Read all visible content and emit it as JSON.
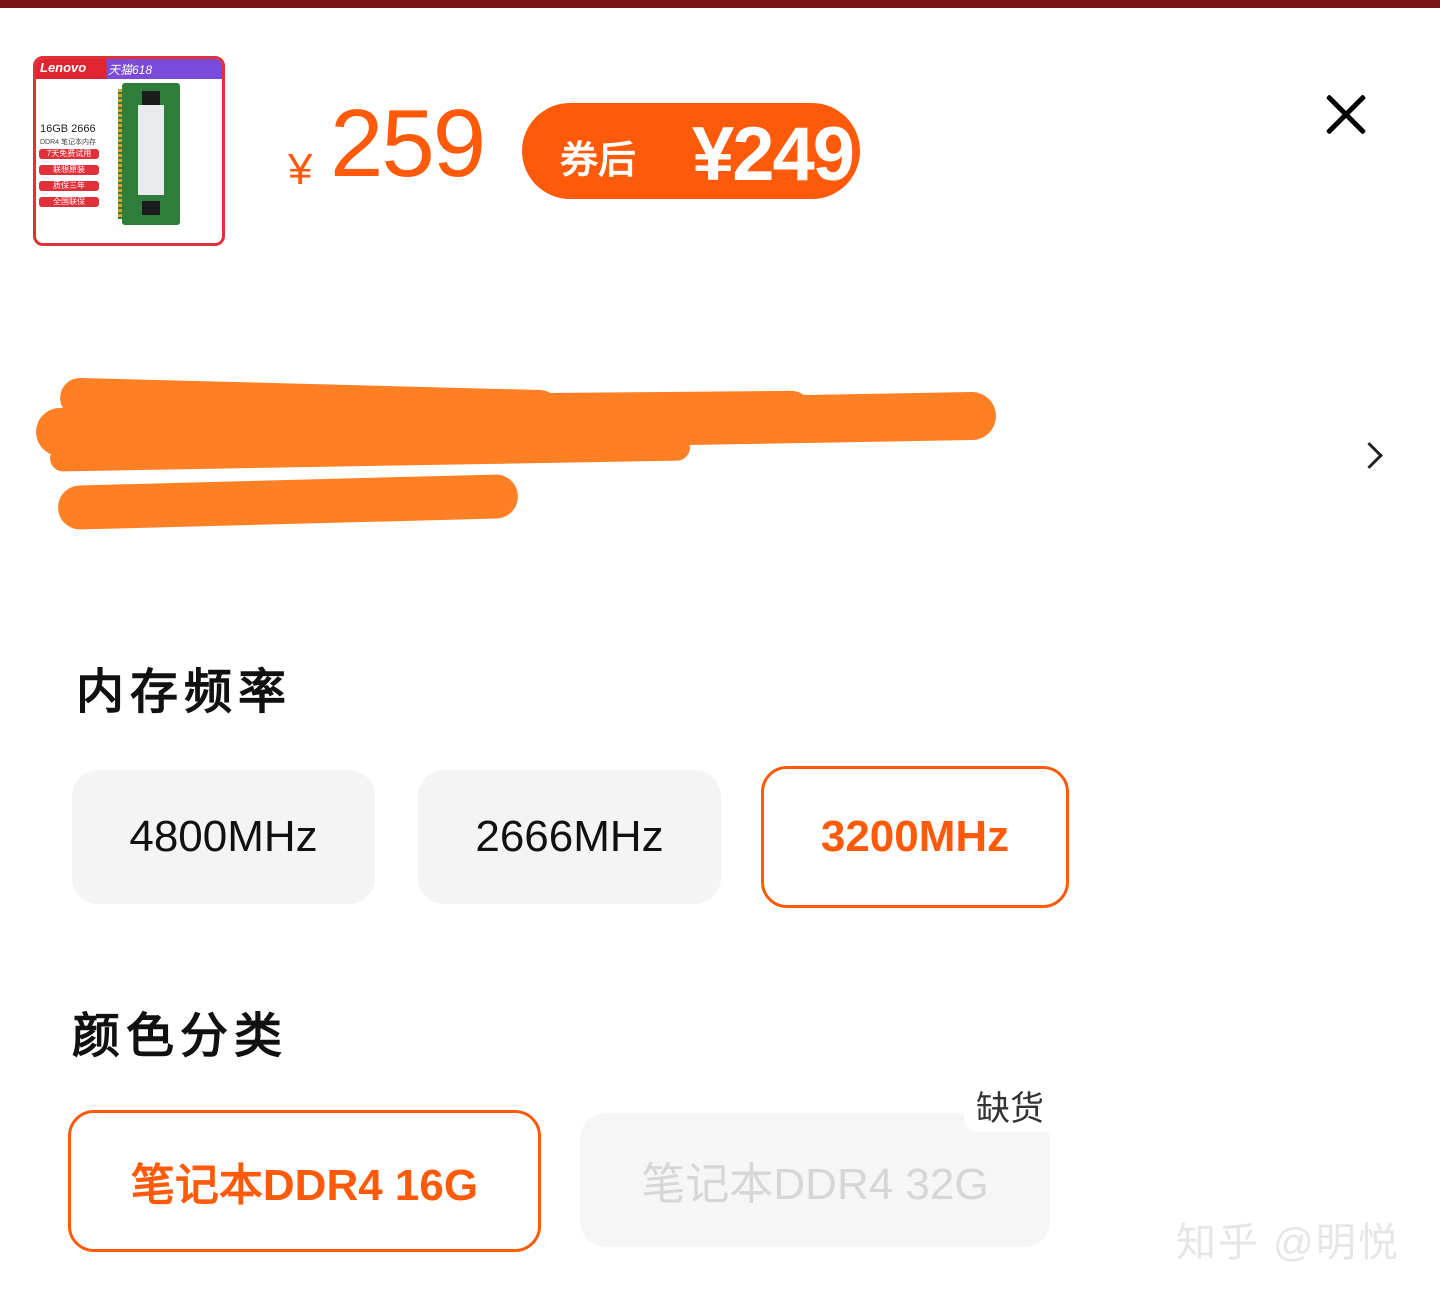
{
  "product": {
    "thumb_brand": "Lenovo",
    "thumb_promo": "天猫618",
    "thumb_spec": "16GB 2666",
    "thumb_spec_sub": "DDR4 笔记本内存",
    "thumb_tags": [
      "7天免费试用",
      "联想原装",
      "质保三年",
      "全国联保"
    ]
  },
  "price": {
    "currency": "¥",
    "original": "259",
    "coupon_label": "券后",
    "coupon_price": "¥249"
  },
  "colors": {
    "accent": "#ff5a0a",
    "redaction": "#ff7f24"
  },
  "memory_frequency": {
    "title": "内存频率",
    "options": [
      {
        "label": "4800MHz",
        "state": "available"
      },
      {
        "label": "2666MHz",
        "state": "available"
      },
      {
        "label": "3200MHz",
        "state": "selected"
      }
    ]
  },
  "color_category": {
    "title": "颜色分类",
    "options": [
      {
        "label": "笔记本DDR4 16G",
        "state": "selected"
      },
      {
        "label": "笔记本DDR4 32G",
        "state": "disabled",
        "badge": "缺货"
      }
    ]
  },
  "watermark": "知乎 @明悦",
  "icons": {
    "close": "close-icon",
    "chevron": "chevron-right-icon"
  }
}
